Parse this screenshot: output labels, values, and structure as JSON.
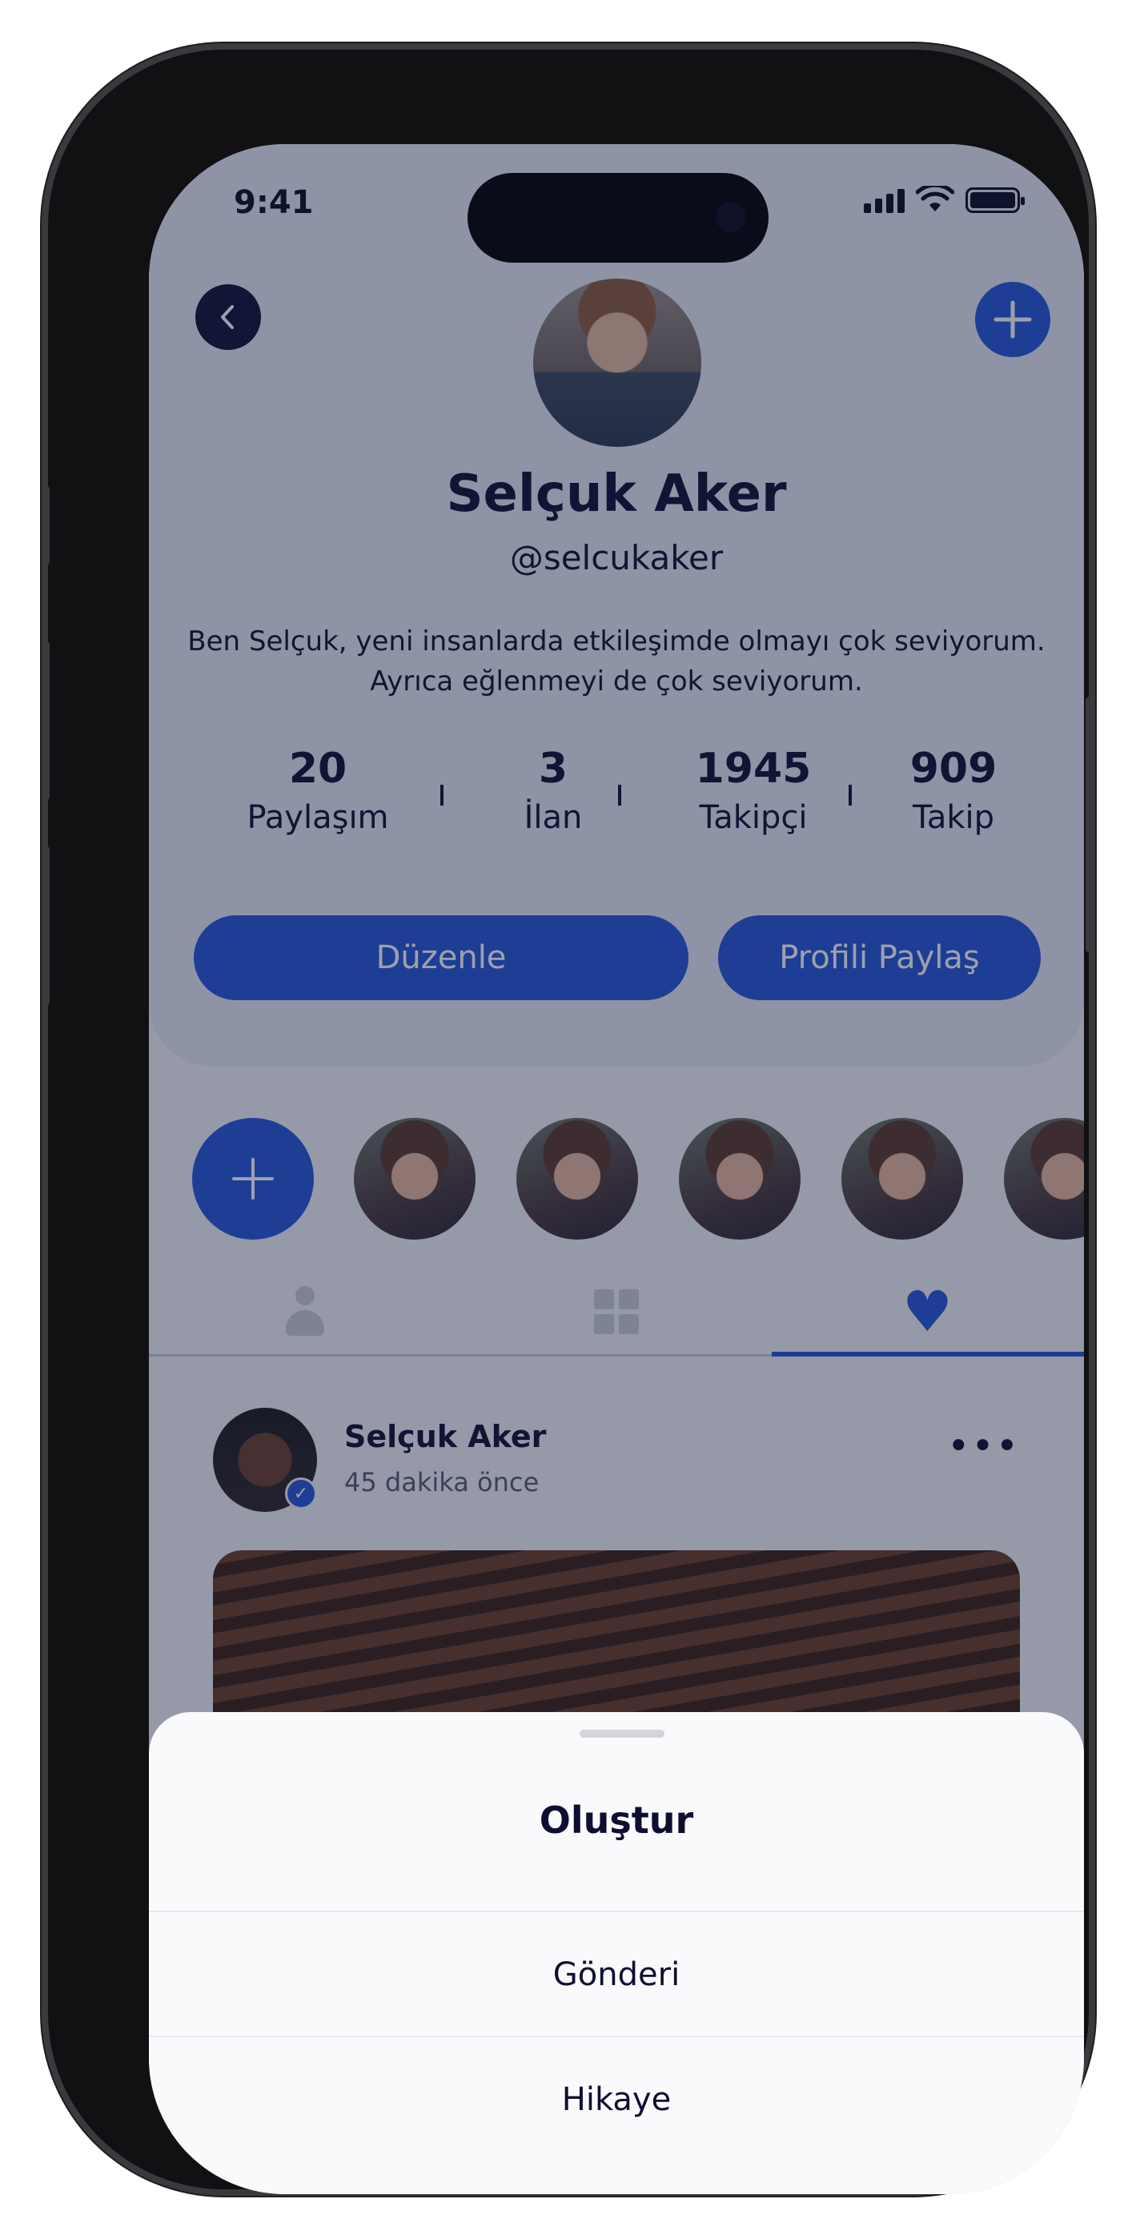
{
  "status_bar": {
    "time": "9:41"
  },
  "profile": {
    "name": "Selçuk Aker",
    "handle": "@selcukaker",
    "bio": "Ben Selçuk, yeni insanlarda etkileşimde olmayı çok seviyorum. Ayrıca eğlenmeyi de çok seviyorum.",
    "stats": [
      {
        "value": "20",
        "label": "Paylaşım"
      },
      {
        "value": "3",
        "label": "İlan"
      },
      {
        "value": "1945",
        "label": "Takipçi"
      },
      {
        "value": "909",
        "label": "Takip"
      }
    ],
    "edit_label": "Düzenle",
    "share_label": "Profili Paylaş"
  },
  "icons": {
    "back": "chevron-left-icon",
    "add": "plus-icon",
    "tabs": [
      "person-icon",
      "grid-icon",
      "heart-icon"
    ],
    "more": "more-horizontal-icon"
  },
  "tabs": {
    "active_index": 2
  },
  "post": {
    "author": "Selçuk Aker",
    "time": "45 dakika önce"
  },
  "sheet": {
    "title": "Oluştur",
    "items": [
      "Gönderi",
      "Hikaye"
    ]
  },
  "colors": {
    "accent": "#2557d6",
    "dark": "#0e0f30",
    "overlay": "rgba(22,28,60,0.42)"
  }
}
